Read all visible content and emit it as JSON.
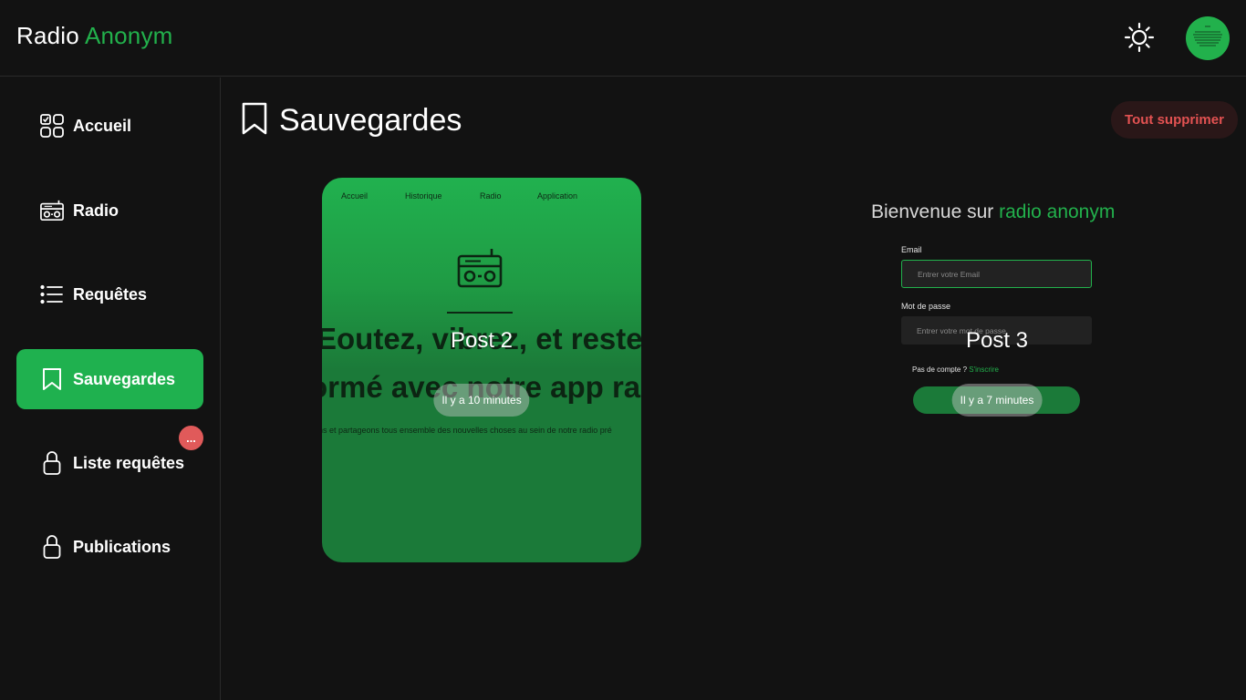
{
  "header": {
    "brand_prefix": "Radio",
    "brand_accent": "Anonym",
    "theme_toggle_icon": "sun-icon"
  },
  "colors": {
    "accent": "#22b14c",
    "background": "#121212",
    "danger": "#e35252"
  },
  "sidebar": {
    "items": [
      {
        "label": "Accueil",
        "icon": "dashboard-icon"
      },
      {
        "label": "Radio",
        "icon": "radio-icon"
      },
      {
        "label": "Requêtes",
        "icon": "list-icon"
      },
      {
        "label": "Sauvegardes",
        "icon": "bookmark-icon",
        "active": true
      },
      {
        "label": "Liste requêtes",
        "icon": "lock-icon"
      },
      {
        "label": "Publications",
        "icon": "lock-icon"
      }
    ],
    "badge": "..."
  },
  "main": {
    "title": "Sauvegardes",
    "delete_all_label": "Tout supprimer"
  },
  "posts": [
    {
      "title": "Post 2",
      "time": "Il y a 10 minutes",
      "preview": {
        "nav": [
          "Accueil",
          "Historique",
          "Radio",
          "Application"
        ],
        "headline_line1": "Eoutez, vibrez, et reste",
        "headline_line2": "ormé avec notre app ra",
        "subtext": "ns et partageons tous ensemble des nouvelles choses au sein de notre radio pré"
      }
    },
    {
      "title": "Post 3",
      "time": "Il y a 7 minutes",
      "preview": {
        "welcome_prefix": "Bienvenue sur",
        "welcome_accent": "radio anonym",
        "email_label": "Email",
        "email_placeholder": "Entrer votre Email",
        "password_label": "Mot de passe",
        "password_placeholder": "Entrer votre mot de passe",
        "signup_prefix": "Pas de compte ?",
        "signup_link": "S'inscrire"
      }
    }
  ]
}
